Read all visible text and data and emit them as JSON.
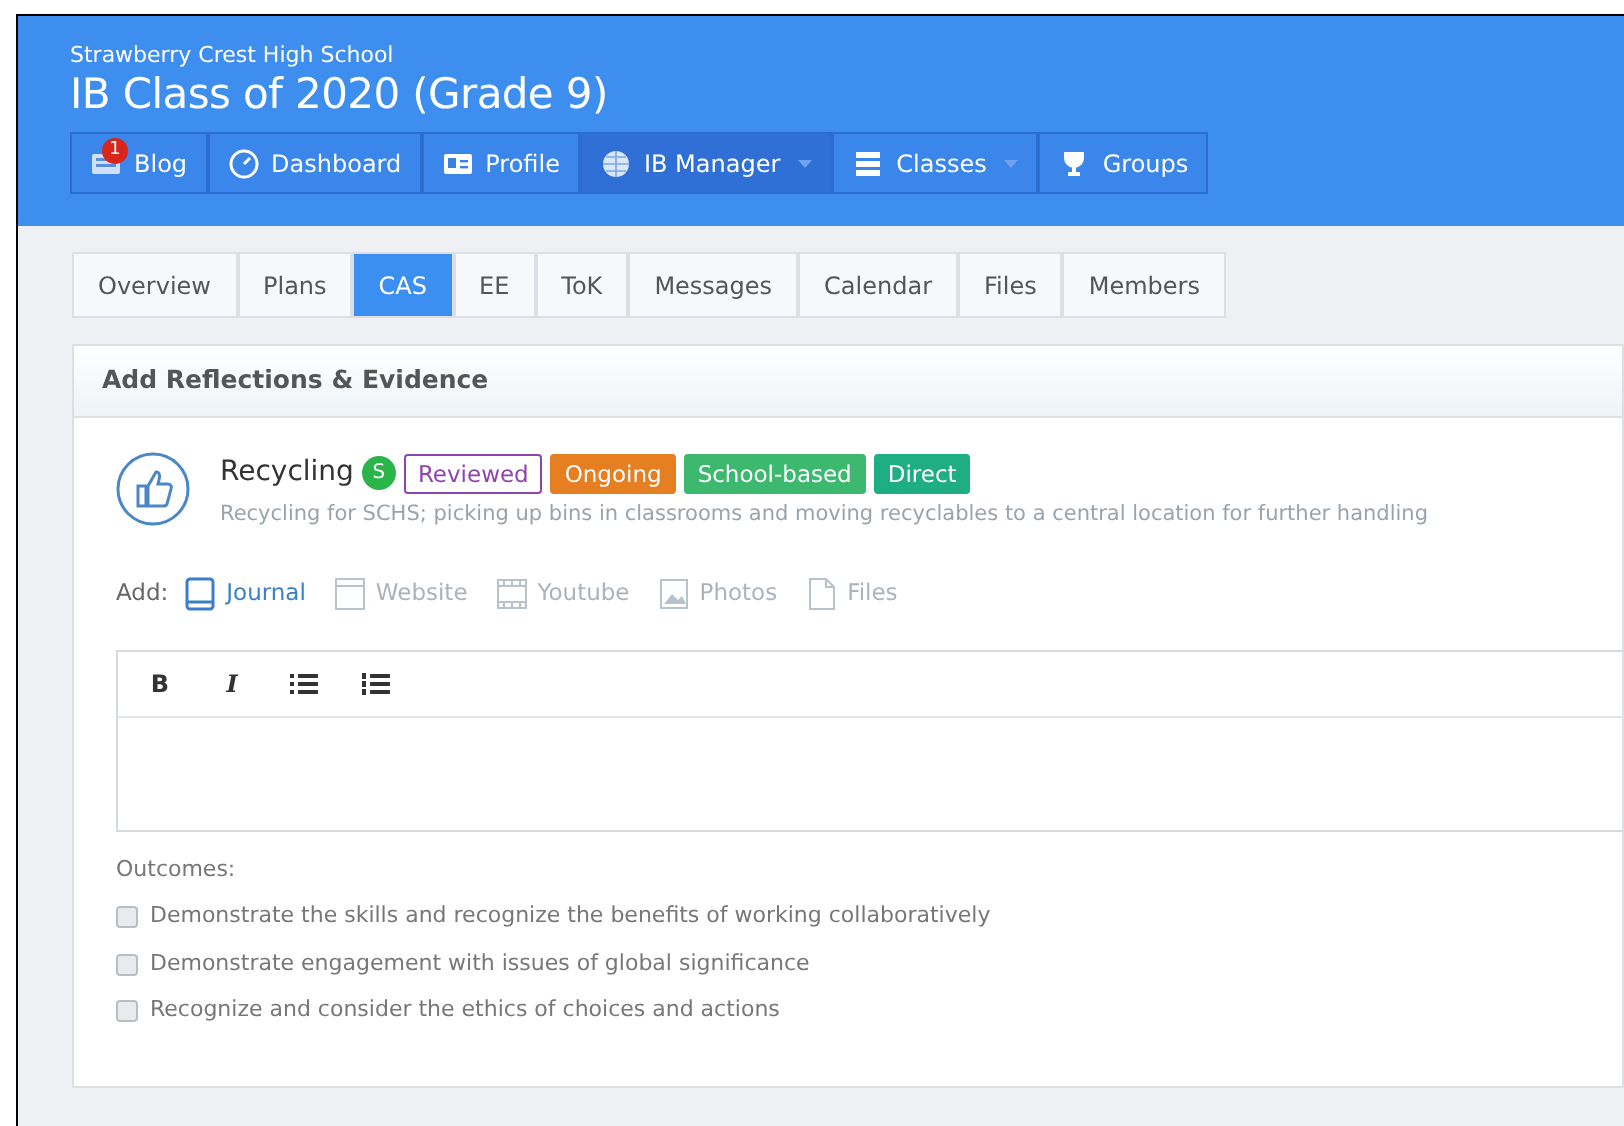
{
  "header": {
    "school": "Strawberry Crest High School",
    "title": "IB Class of 2020 (Grade 9)"
  },
  "nav": [
    {
      "label": "Blog",
      "badge": "1",
      "selected": false,
      "dropdown": false
    },
    {
      "label": "Dashboard",
      "selected": false,
      "dropdown": false
    },
    {
      "label": "Profile",
      "selected": false,
      "dropdown": false
    },
    {
      "label": "IB Manager",
      "selected": true,
      "dropdown": true
    },
    {
      "label": "Classes",
      "selected": false,
      "dropdown": true
    },
    {
      "label": "Groups",
      "selected": false,
      "dropdown": false
    }
  ],
  "tabs": [
    {
      "label": "Overview",
      "selected": false
    },
    {
      "label": "Plans",
      "selected": false
    },
    {
      "label": "CAS",
      "selected": true
    },
    {
      "label": "EE",
      "selected": false
    },
    {
      "label": "ToK",
      "selected": false
    },
    {
      "label": "Messages",
      "selected": false
    },
    {
      "label": "Calendar",
      "selected": false
    },
    {
      "label": "Files",
      "selected": false
    },
    {
      "label": "Members",
      "selected": false
    }
  ],
  "card": {
    "title": "Add Reflections & Evidence",
    "activity": {
      "name": "Recycling",
      "avatar": "S",
      "description": "Recycling for SCHS; picking up bins in classrooms and moving recyclables to a central location for further handling",
      "tags": [
        {
          "label": "Reviewed",
          "color": "#8e44ad",
          "kind": "outline"
        },
        {
          "label": "Ongoing",
          "color": "#e67e22",
          "kind": "solid"
        },
        {
          "label": "School-based",
          "color": "#3cb96f",
          "kind": "solid"
        },
        {
          "label": "Direct",
          "color": "#1fae84",
          "kind": "solid"
        }
      ]
    },
    "add": {
      "label": "Add:",
      "items": [
        {
          "label": "Journal",
          "selected": true
        },
        {
          "label": "Website",
          "selected": false
        },
        {
          "label": "Youtube",
          "selected": false
        },
        {
          "label": "Photos",
          "selected": false
        },
        {
          "label": "Files",
          "selected": false
        }
      ]
    },
    "editor": {
      "tools": [
        {
          "label": "B",
          "kind": "bold"
        },
        {
          "label": "I",
          "kind": "italic"
        },
        {
          "kind": "bullets"
        },
        {
          "kind": "numbers"
        }
      ]
    },
    "outcomes": {
      "label": "Outcomes:",
      "items": [
        {
          "label": "Demonstrate the skills and recognize the benefits of working collaboratively",
          "checked": false
        },
        {
          "label": "Demonstrate engagement with issues of global significance",
          "checked": false
        },
        {
          "label": "Recognize and consider the ethics of choices and actions",
          "checked": false
        }
      ]
    }
  }
}
